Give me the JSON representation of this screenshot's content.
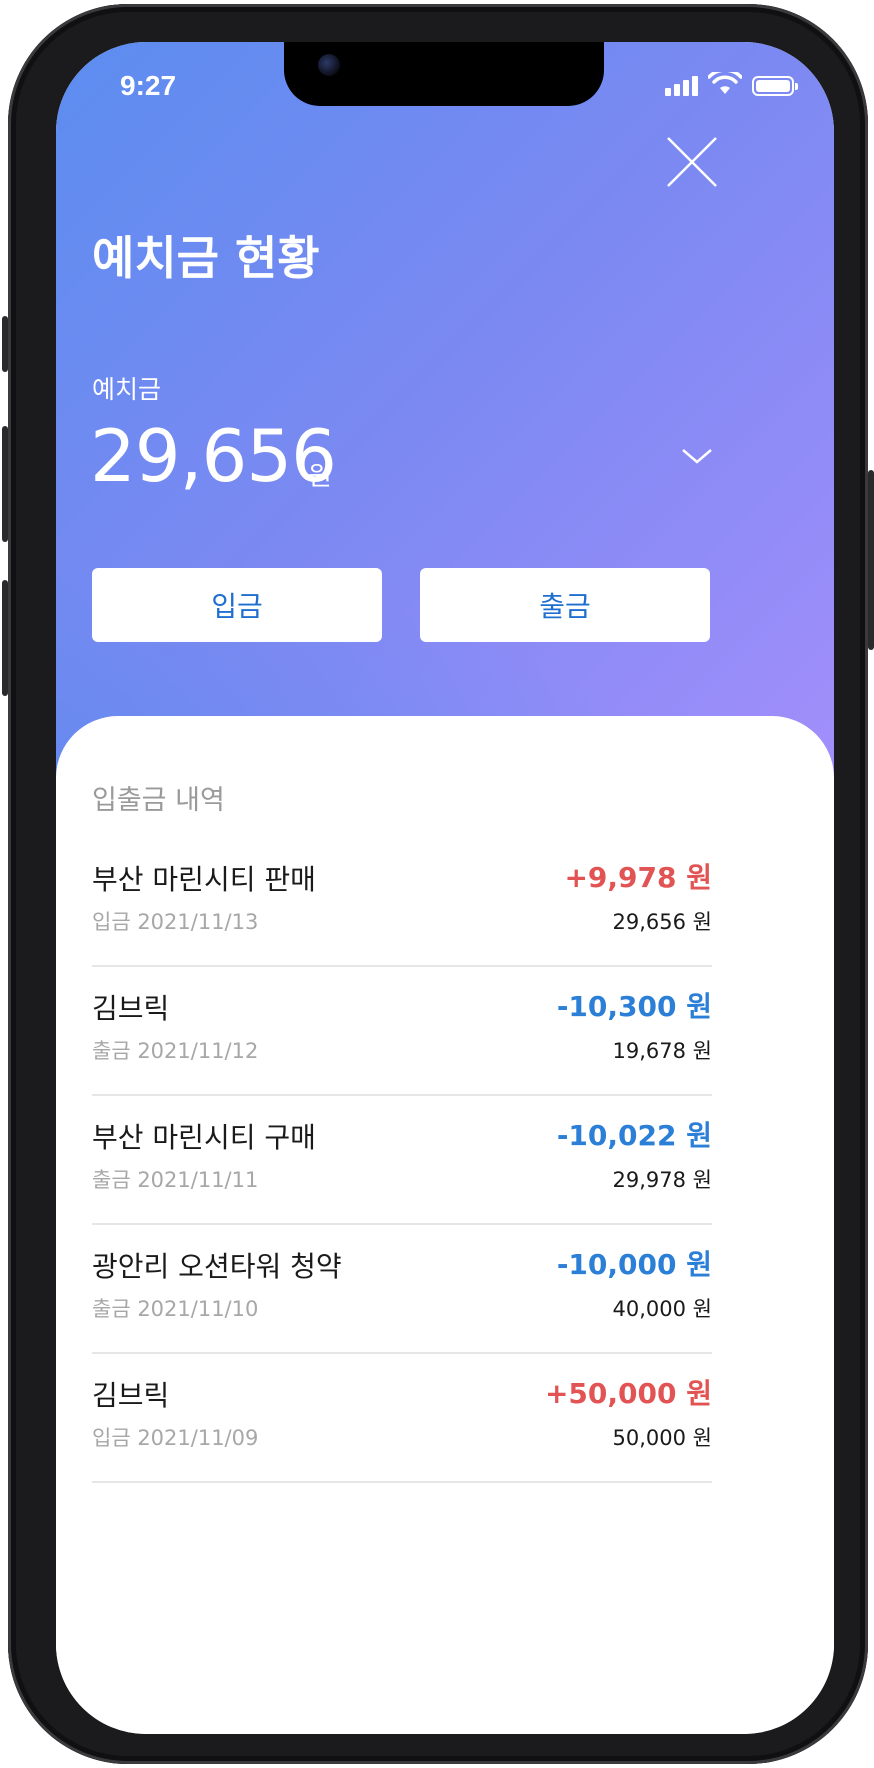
{
  "status_bar": {
    "time": "9:27"
  },
  "header": {
    "title": "예치금 현황",
    "deposit_label": "예치금",
    "deposit_amount": "29,656",
    "deposit_unit": "원"
  },
  "actions": {
    "deposit_label": "입금",
    "withdraw_label": "출금"
  },
  "history": {
    "title": "입출금 내역",
    "items": [
      {
        "name": "부산 마린시티 판매",
        "meta": "입금 2021/11/13",
        "amount": "+9,978 원",
        "balance": "29,656 원",
        "type": "plus"
      },
      {
        "name": "김브릭",
        "meta": "출금 2021/11/12",
        "amount": "-10,300 원",
        "balance": "19,678 원",
        "type": "minus"
      },
      {
        "name": "부산 마린시티 구매",
        "meta": "출금 2021/11/11",
        "amount": "-10,022 원",
        "balance": "29,978 원",
        "type": "minus"
      },
      {
        "name": "광안리 오션타워 청약",
        "meta": "출금 2021/11/10",
        "amount": "-10,000 원",
        "balance": "40,000 원",
        "type": "minus"
      },
      {
        "name": "김브릭",
        "meta": "입금 2021/11/09",
        "amount": "+50,000 원",
        "balance": "50,000 원",
        "type": "plus"
      }
    ]
  },
  "colors": {
    "plus": "#e25454",
    "minus": "#2b7fd6",
    "button_text": "#1f6fd1"
  }
}
